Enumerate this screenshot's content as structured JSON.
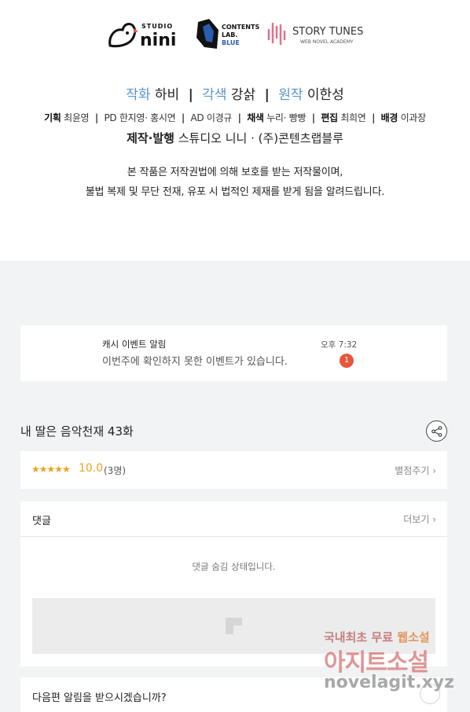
{
  "credits": {
    "logos": {
      "studio": "STUDIO",
      "nini": "nini",
      "contents_line1": "CONTENTS",
      "contents_line2": "LAB.",
      "contents_line3": "BLUE",
      "story_tunes": "STORY TUNES",
      "story_sub": "WEB NOVEL ACADEMY"
    },
    "main": {
      "role1": "작화",
      "name1": "하비",
      "role2": "각색",
      "name2": "강삵",
      "role3": "원작",
      "name3": "이한성",
      "separator": "|"
    },
    "sub": {
      "plan_label": "기획",
      "plan_name": "최윤영",
      "pd_label": "PD",
      "pd_name": "한지영· 홍시연",
      "ad_label": "AD",
      "ad_name": "이경규",
      "color_label": "채색",
      "color_name": "누리· 빵빵",
      "edit_label": "편집",
      "edit_name": "최희연",
      "bg_label": "배경",
      "bg_name": "이과장",
      "separator": "|"
    },
    "production": {
      "label": "제작·발행",
      "names": "스튜디오 니니 · (주)콘텐츠랩블루"
    },
    "copyright_line1": "본 작품은 저작권법에 의해 보호를 받는 저작물이며,",
    "copyright_line2": "불법 복제 및 무단 전재, 유포 시 법적인 제재를 받게 됨을 알려드립니다."
  },
  "notification": {
    "title": "캐시 이벤트 알림",
    "message": "이번주에 확인하지 못한 이벤트가 있습니다.",
    "time": "오후 7:32",
    "badge": "1"
  },
  "episode": {
    "title": "내 딸은 음악천재 43화"
  },
  "rating": {
    "stars": "★★★★★",
    "score": "10.0",
    "count": "(3명)",
    "rate_link": "별점주기 ›"
  },
  "comments": {
    "title": "댓글",
    "more_link": "더보기 ›",
    "hidden_message": "댓글 숨김 상태입니다."
  },
  "next_episode": {
    "question": "다음편 알림을 받으시겠습니까?"
  },
  "watermark": {
    "line1_a": "국내최초 무료",
    "line1_b": "웹소설",
    "line2": "아지트소설",
    "line3": "novelagit.xyz"
  },
  "colors": {
    "role_blue": "#5a93d2",
    "rating_orange": "#f0a11b",
    "badge_red": "#e8553c",
    "page_bg": "#f2f3f5"
  }
}
